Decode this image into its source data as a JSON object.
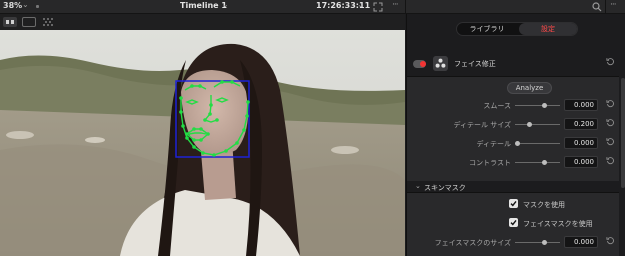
{
  "topbar": {
    "zoom": "38%",
    "timeline_name": "Timeline 1",
    "timecode": "17:26:33:11"
  },
  "panel": {
    "tabs": [
      {
        "label": "ライブラリ",
        "active": false
      },
      {
        "label": "設定",
        "active": true
      }
    ],
    "effect_title": "フェイス修正",
    "analyze_label": "Analyze",
    "sliders": [
      {
        "label": "スムース",
        "value": "0.000",
        "position": 0.65
      },
      {
        "label": "ディテール サイズ",
        "value": "0.200",
        "position": 0.3
      },
      {
        "label": "ディテール",
        "value": "0.000",
        "position": 0.05
      },
      {
        "label": "コントラスト",
        "value": "0.000",
        "position": 0.65
      }
    ],
    "skin_section": {
      "title": "スキンマスク",
      "checkboxes": [
        {
          "label": "マスクを使用",
          "checked": true
        },
        {
          "label": "フェイスマスクを使用",
          "checked": true
        }
      ],
      "slider": {
        "label": "フェイスマスクのサイズ",
        "value": "0.000",
        "position": 0.65
      }
    }
  },
  "colors": {
    "accent_red": "#ff4a4a",
    "tracking_green": "#22dd44",
    "face_box": "#1e22d6"
  },
  "icons": [
    "chevron-down-icon",
    "expand-icon",
    "more-icon",
    "search-icon",
    "reset-icon",
    "face-effect-icon",
    "checkmark-icon",
    "sparkle-icon"
  ]
}
